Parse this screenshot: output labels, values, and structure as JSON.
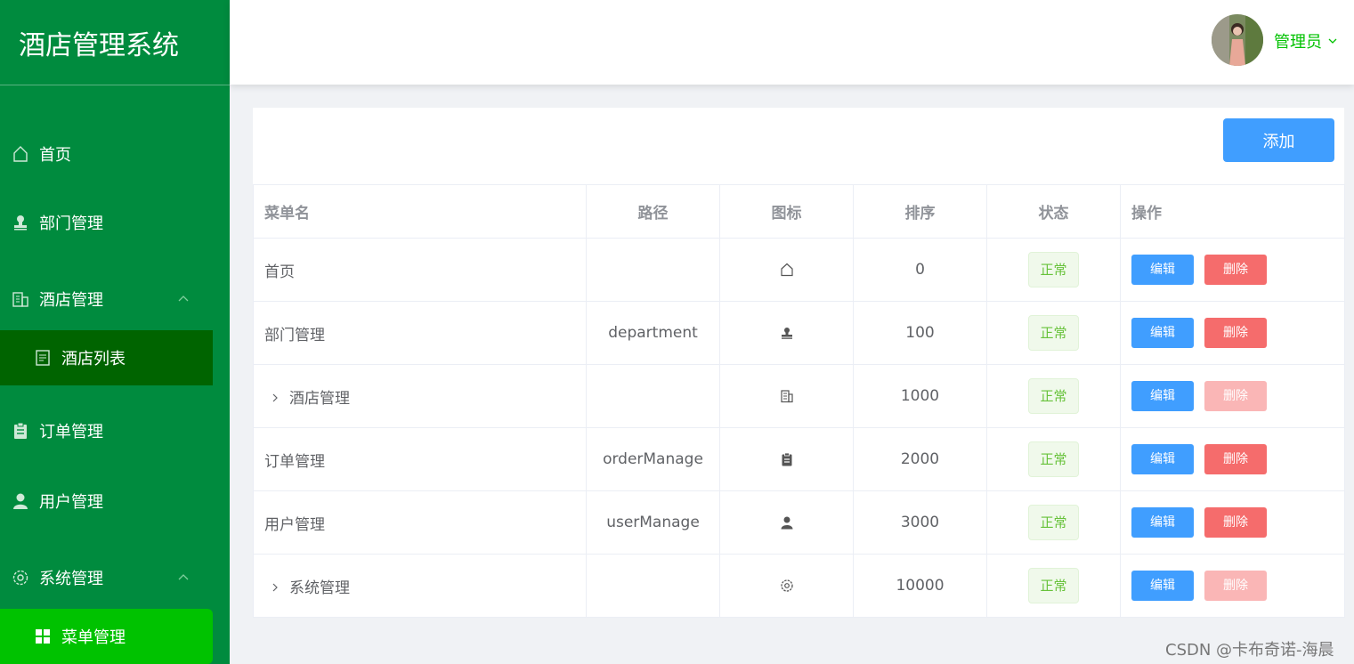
{
  "app": {
    "title": "酒店管理系统"
  },
  "sidebar": {
    "items": [
      {
        "label": "首页",
        "icon": "home-icon"
      },
      {
        "label": "部门管理",
        "icon": "stamp-icon"
      },
      {
        "label": "酒店管理",
        "icon": "office-building-icon",
        "expanded": true,
        "children": [
          {
            "label": "酒店列表",
            "icon": "document-icon"
          }
        ]
      },
      {
        "label": "订单管理",
        "icon": "clipboard-icon"
      },
      {
        "label": "用户管理",
        "icon": "user-icon"
      },
      {
        "label": "系统管理",
        "icon": "setting-icon",
        "expanded": true,
        "children": [
          {
            "label": "菜单管理",
            "icon": "menu-grid-icon",
            "active": true
          }
        ]
      }
    ]
  },
  "header": {
    "user_name": "管理员"
  },
  "toolbar": {
    "add_label": "添加"
  },
  "table": {
    "columns": [
      "菜单名",
      "路径",
      "图标",
      "排序",
      "状态",
      "操作"
    ],
    "rows": [
      {
        "name": "首页",
        "path": "",
        "icon": "home-icon",
        "sort": "0",
        "status": "正常",
        "edit": "编辑",
        "delete": "删除",
        "expandable": false,
        "delete_disabled": false
      },
      {
        "name": "部门管理",
        "path": "department",
        "icon": "stamp-icon",
        "sort": "100",
        "status": "正常",
        "edit": "编辑",
        "delete": "删除",
        "expandable": false,
        "delete_disabled": false
      },
      {
        "name": "酒店管理",
        "path": "",
        "icon": "office-building-icon",
        "sort": "1000",
        "status": "正常",
        "edit": "编辑",
        "delete": "删除",
        "expandable": true,
        "delete_disabled": true
      },
      {
        "name": "订单管理",
        "path": "orderManage",
        "icon": "clipboard-icon",
        "sort": "2000",
        "status": "正常",
        "edit": "编辑",
        "delete": "删除",
        "expandable": false,
        "delete_disabled": false
      },
      {
        "name": "用户管理",
        "path": "userManage",
        "icon": "user-icon",
        "sort": "3000",
        "status": "正常",
        "edit": "编辑",
        "delete": "删除",
        "expandable": false,
        "delete_disabled": false
      },
      {
        "name": "系统管理",
        "path": "",
        "icon": "setting-icon",
        "sort": "10000",
        "status": "正常",
        "edit": "编辑",
        "delete": "删除",
        "expandable": true,
        "delete_disabled": true
      }
    ]
  },
  "watermark": "CSDN @卡布奇诺-海晨",
  "colors": {
    "sidebar_bg": "#008b3e",
    "active_item": "#00c200",
    "primary": "#409eff",
    "danger": "#f56c6c",
    "success_text": "#67c23a"
  }
}
